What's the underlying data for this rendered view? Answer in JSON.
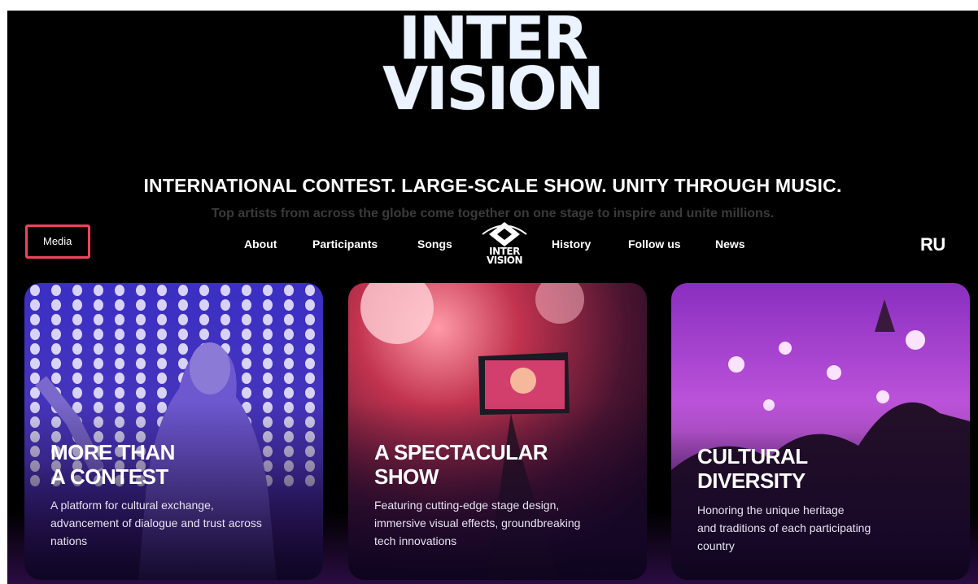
{
  "hero": {
    "logo_line1": "INTER",
    "logo_line2": "VISION",
    "tagline": "INTERNATIONAL CONTEST. LARGE-SCALE SHOW. UNITY THROUGH MUSIC.",
    "subtitle": "Top artists from across the globe come together on one stage to inspire and unite millions."
  },
  "nav": {
    "media": "Media",
    "items": [
      "About",
      "Participants",
      "Songs",
      "History",
      "Follow us",
      "News"
    ],
    "logo_line1": "INTER",
    "logo_line2": "VISION",
    "lang": "RU"
  },
  "cards": [
    {
      "title": "MORE THAN\nA CONTEST",
      "desc": "A platform for cultural exchange,\nadvancement of dialogue and trust across\nnations"
    },
    {
      "title": "A SPECTACULAR\nSHOW",
      "desc": "Featuring cutting-edge stage design,\nimmersive visual effects, groundbreaking\ntech innovations"
    },
    {
      "title": "CULTURAL\nDIVERSITY",
      "desc": "Honoring the unique heritage\nand traditions of each participating\ncountry"
    }
  ],
  "colors": {
    "background": "#000000",
    "highlight_border": "#f0435e",
    "logo": "#eaf3ff"
  }
}
